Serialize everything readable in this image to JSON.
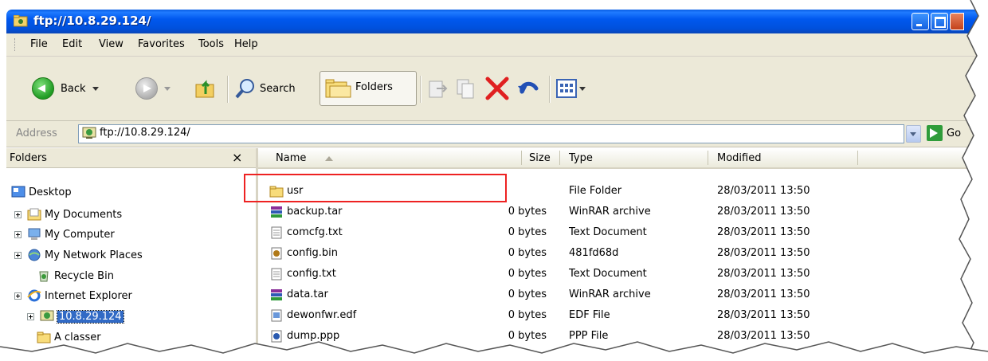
{
  "window": {
    "title": "ftp://10.8.29.124/"
  },
  "menu": [
    "File",
    "Edit",
    "View",
    "Favorites",
    "Tools",
    "Help"
  ],
  "toolbar": {
    "back_label": "Back",
    "search_label": "Search",
    "folders_label": "Folders"
  },
  "address": {
    "label": "Address",
    "value": "ftp://10.8.29.124/",
    "go_label": "Go"
  },
  "folders_pane": {
    "title": "Folders",
    "close_glyph": "×",
    "items": [
      {
        "label": "Desktop",
        "icon": "desktop-icon"
      },
      {
        "label": "My Documents",
        "icon": "documents-folder-icon"
      },
      {
        "label": "My Computer",
        "icon": "computer-icon"
      },
      {
        "label": "My Network Places",
        "icon": "network-icon"
      },
      {
        "label": "Recycle Bin",
        "icon": "recycle-bin-icon"
      },
      {
        "label": "Internet Explorer",
        "icon": "internet-explorer-icon"
      },
      {
        "label": "10.8.29.124",
        "icon": "ftp-site-icon"
      },
      {
        "label": "A classer",
        "icon": "folder-icon"
      }
    ]
  },
  "columns": {
    "name": "Name",
    "size": "Size",
    "type": "Type",
    "modified": "Modified"
  },
  "files": [
    {
      "name": "usr",
      "size": "",
      "type": "File Folder",
      "modified": "28/03/2011 13:50",
      "icon": "folder-icon"
    },
    {
      "name": "backup.tar",
      "size": "0 bytes",
      "type": "WinRAR archive",
      "modified": "28/03/2011 13:50",
      "icon": "winrar-icon"
    },
    {
      "name": "comcfg.txt",
      "size": "0 bytes",
      "type": "Text Document",
      "modified": "28/03/2011 13:50",
      "icon": "text-document-icon"
    },
    {
      "name": "config.bin",
      "size": "0 bytes",
      "type": "481fd68d",
      "modified": "28/03/2011 13:50",
      "icon": "binary-file-icon"
    },
    {
      "name": "config.txt",
      "size": "0 bytes",
      "type": "Text Document",
      "modified": "28/03/2011 13:50",
      "icon": "text-document-icon"
    },
    {
      "name": "data.tar",
      "size": "0 bytes",
      "type": "WinRAR archive",
      "modified": "28/03/2011 13:50",
      "icon": "winrar-icon"
    },
    {
      "name": "dewonfwr.edf",
      "size": "0 bytes",
      "type": "EDF File",
      "modified": "28/03/2011 13:50",
      "icon": "edf-file-icon"
    },
    {
      "name": "dump.ppp",
      "size": "0 bytes",
      "type": "PPP File",
      "modified": "28/03/2011 13:50",
      "icon": "ppp-file-icon"
    }
  ],
  "colors": {
    "titlebar": "#0058ee",
    "chrome": "#ece9d8",
    "selection": "#316ac5",
    "annotation": "#ee2222"
  }
}
